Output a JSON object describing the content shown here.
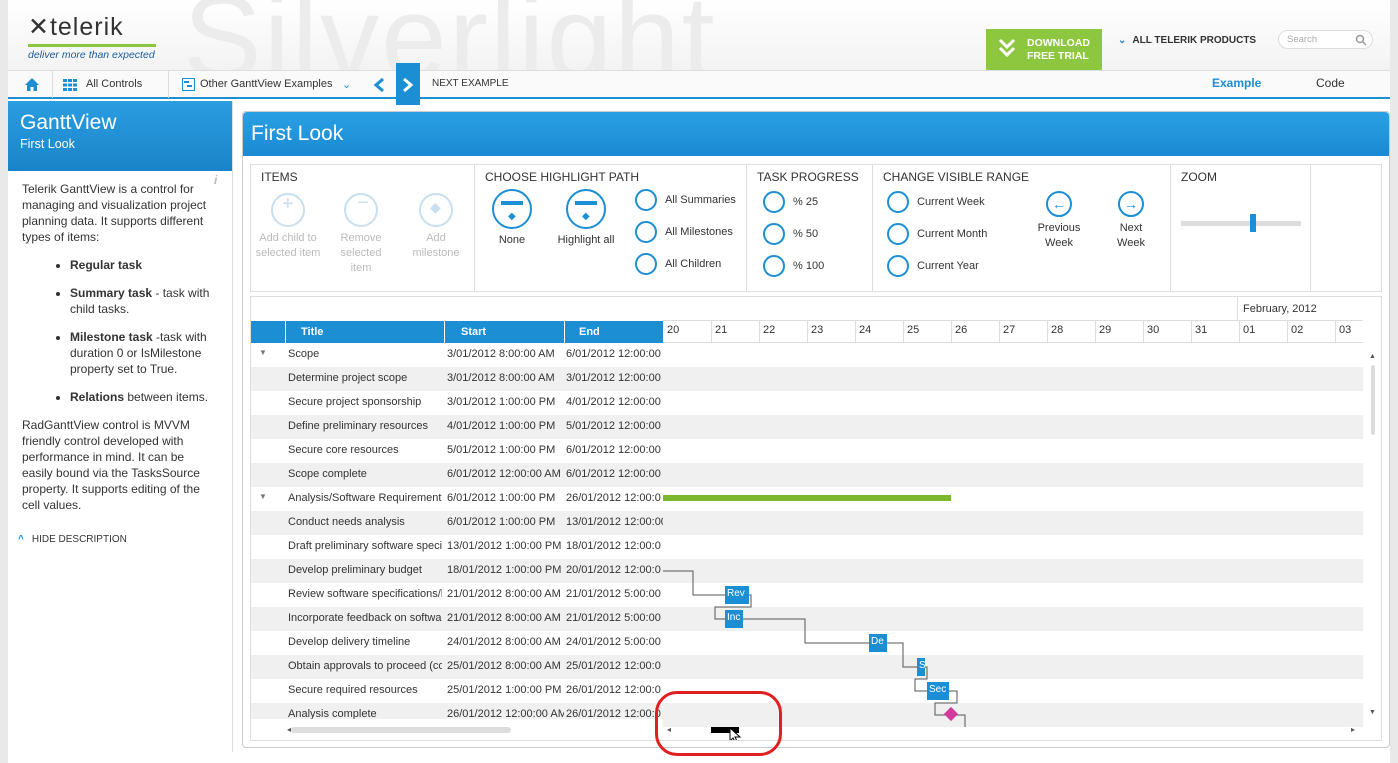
{
  "brand": {
    "name": "telerik",
    "tagline": "deliver more than expected",
    "bg_word": "Silverlight",
    "accent": "#1b8ed4",
    "green": "#8dc63f"
  },
  "topbar": {
    "download_line1": "DOWNLOAD",
    "download_line2": "FREE TRIAL",
    "all_products": "ALL TELERIK PRODUCTS",
    "search_placeholder": "Search"
  },
  "nav": {
    "all_controls": "All Controls",
    "other_examples": "Other GanttView Examples",
    "next_example": "NEXT EXAMPLE",
    "tab_example": "Example",
    "tab_code": "Code"
  },
  "sidebar": {
    "title": "GanttView",
    "subtitle": "First Look",
    "intro": "Telerik GanttView is a control for managing and visualization project planning data. It supports different types of items:",
    "items": [
      {
        "bold": "Regular task",
        "rest": ""
      },
      {
        "bold": "Summary task",
        "rest": " - task with child tasks."
      },
      {
        "bold": "Milestone task",
        "rest": " -task with duration 0 or IsMilestone property set to True."
      },
      {
        "bold": "Relations",
        "rest": " between items."
      }
    ],
    "outro": "RadGanttView control is MVVM friendly control developed with performance in mind. It can be easily bound via the TasksSource property. It supports editing of the cell values.",
    "hide": "HIDE DESCRIPTION"
  },
  "main": {
    "title": "First Look"
  },
  "ribbon": {
    "items": {
      "title": "ITEMS",
      "add_child": "Add child to selected item",
      "remove": "Remove selected item",
      "add_milestone": "Add milestone"
    },
    "highlight": {
      "title": "CHOOSE HIGHLIGHT PATH",
      "none": "None",
      "all": "Highlight all",
      "summaries": "All Summaries",
      "milestones": "All Milestones",
      "children": "All Children"
    },
    "progress": {
      "title": "TASK PROGRESS",
      "p25": "% 25",
      "p50": "% 50",
      "p100": "% 100"
    },
    "range": {
      "title": "CHANGE VISIBLE RANGE",
      "week": "Current Week",
      "month": "Current Month",
      "year": "Current Year",
      "prev": "Previous Week",
      "next": "Next Week"
    },
    "zoom": {
      "title": "ZOOM",
      "level": 0.6
    }
  },
  "grid": {
    "columns": [
      "Title",
      "Start",
      "End"
    ],
    "rows": [
      {
        "title": "Scope",
        "start": "3/01/2012 8:00:00 AM",
        "end": "6/01/2012 12:00:00",
        "summary": true
      },
      {
        "title": "Determine project scope",
        "start": "3/01/2012 8:00:00 AM",
        "end": "3/01/2012 12:00:00"
      },
      {
        "title": "Secure project sponsorship",
        "start": "3/01/2012 1:00:00 PM",
        "end": "4/01/2012 12:00:00"
      },
      {
        "title": "Define preliminary resources",
        "start": "4/01/2012 1:00:00 PM",
        "end": "5/01/2012 12:00:00"
      },
      {
        "title": "Secure core resources",
        "start": "5/01/2012 1:00:00 PM",
        "end": "6/01/2012 12:00:00"
      },
      {
        "title": "Scope complete",
        "start": "6/01/2012 12:00:00 AM",
        "end": "6/01/2012 12:00:00"
      },
      {
        "title": "Analysis/Software Requirements",
        "start": "6/01/2012 1:00:00 PM",
        "end": "26/01/2012 12:00:0",
        "summary": true
      },
      {
        "title": "Conduct needs analysis",
        "start": "6/01/2012 1:00:00 PM",
        "end": "13/01/2012 12:00:00"
      },
      {
        "title": "Draft preliminary software specifications",
        "start": "13/01/2012 1:00:00 PM",
        "end": "18/01/2012 12:00:0"
      },
      {
        "title": "Develop preliminary budget",
        "start": "18/01/2012 1:00:00 PM",
        "end": "20/01/2012 12:00:0"
      },
      {
        "title": "Review software specifications/budget",
        "start": "21/01/2012 8:00:00 AM",
        "end": "21/01/2012 5:00:00"
      },
      {
        "title": "Incorporate feedback on software specifications",
        "start": "21/01/2012 8:00:00 AM",
        "end": "21/01/2012 5:00:00"
      },
      {
        "title": "Develop delivery timeline",
        "start": "24/01/2012 8:00:00 AM",
        "end": "24/01/2012 5:00:00"
      },
      {
        "title": "Obtain approvals to proceed (concept, timeline, budget)",
        "start": "25/01/2012 8:00:00 AM",
        "end": "25/01/2012 12:00:0"
      },
      {
        "title": "Secure required resources",
        "start": "25/01/2012 1:00:00 PM",
        "end": "26/01/2012 12:00:0"
      },
      {
        "title": "Analysis complete",
        "start": "26/01/2012 12:00:00 AM",
        "end": "26/01/2012 12:00:0"
      }
    ]
  },
  "timeline": {
    "month": "February, 2012",
    "days": [
      "20",
      "21",
      "22",
      "23",
      "24",
      "25",
      "26",
      "27",
      "28",
      "29",
      "30",
      "31",
      "01",
      "02",
      "03"
    ],
    "task_labels": [
      "Rev",
      "Inc",
      "De",
      "S",
      "Sec"
    ]
  }
}
